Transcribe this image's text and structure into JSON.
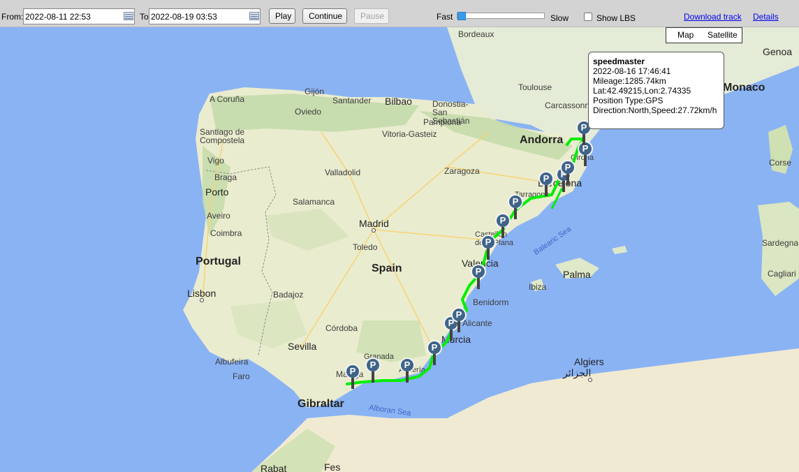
{
  "toolbar": {
    "from_label": "From:",
    "from_value": "2022-08-11 22:53",
    "to_label": "To",
    "to_value": "2022-08-19 03:53",
    "play_label": "Play",
    "continue_label": "Continue",
    "pause_label": "Pause",
    "fast_label": "Fast",
    "slow_label": "Slow",
    "slider_value": 0.0,
    "show_lbs_label": "Show LBS",
    "show_lbs_checked": false,
    "download_label": "Download track",
    "details_label": "Details"
  },
  "map": {
    "type_buttons": [
      "Map",
      "Satellite"
    ],
    "labels": {
      "countries": [
        "Portugal",
        "Spain",
        "Andorra",
        "Gibraltar"
      ],
      "cities": [
        "Bordeaux",
        "Zaragoza",
        "Toulouse",
        "Genoa",
        "Gijón",
        "A Coruña",
        "Santander",
        "Bilbao",
        "Donostia-San Sebastián",
        "Oviedo",
        "Pamplona",
        "Vitoria-Gasteiz",
        "Santiago de Compostela",
        "Vigo",
        "Braga",
        "Porto",
        "Aveiro",
        "Coimbra",
        "Valladolid",
        "Salamanca",
        "Madrid",
        "Toledo",
        "Lisbon",
        "Badajoz",
        "Córdoba",
        "Sevilla",
        "Albufeira",
        "Faro",
        "Granada",
        "Málaga",
        "Almería",
        "Murcia",
        "Alicante",
        "Benidorm",
        "Valencia",
        "Castellón de la Plana",
        "Tarragona",
        "Barcelona",
        "Girona",
        "Carcassonne",
        "Ibiza",
        "Palma",
        "Corse",
        "Sardegna",
        "Cagliari",
        "Algiers",
        "الجزائر",
        "Rabat",
        "Fes",
        "Monaco"
      ],
      "seas": [
        "Balearic Sea",
        "Alboran Sea"
      ]
    }
  },
  "infowindow": {
    "title": "speedmaster",
    "lines": [
      "2022-08-16 17:46:41",
      "Mileage:1285.74km",
      "Lat:42.49215,Lon:2.74335",
      "Position Type:GPS",
      "Direction:North,Speed:27.72km/h"
    ]
  },
  "markers": {
    "glyph": "P",
    "count": 17
  },
  "colors": {
    "route": "#00ee00",
    "marker": "#3f6488",
    "sea": "#8ab3f4",
    "land": "#f0ede4"
  }
}
